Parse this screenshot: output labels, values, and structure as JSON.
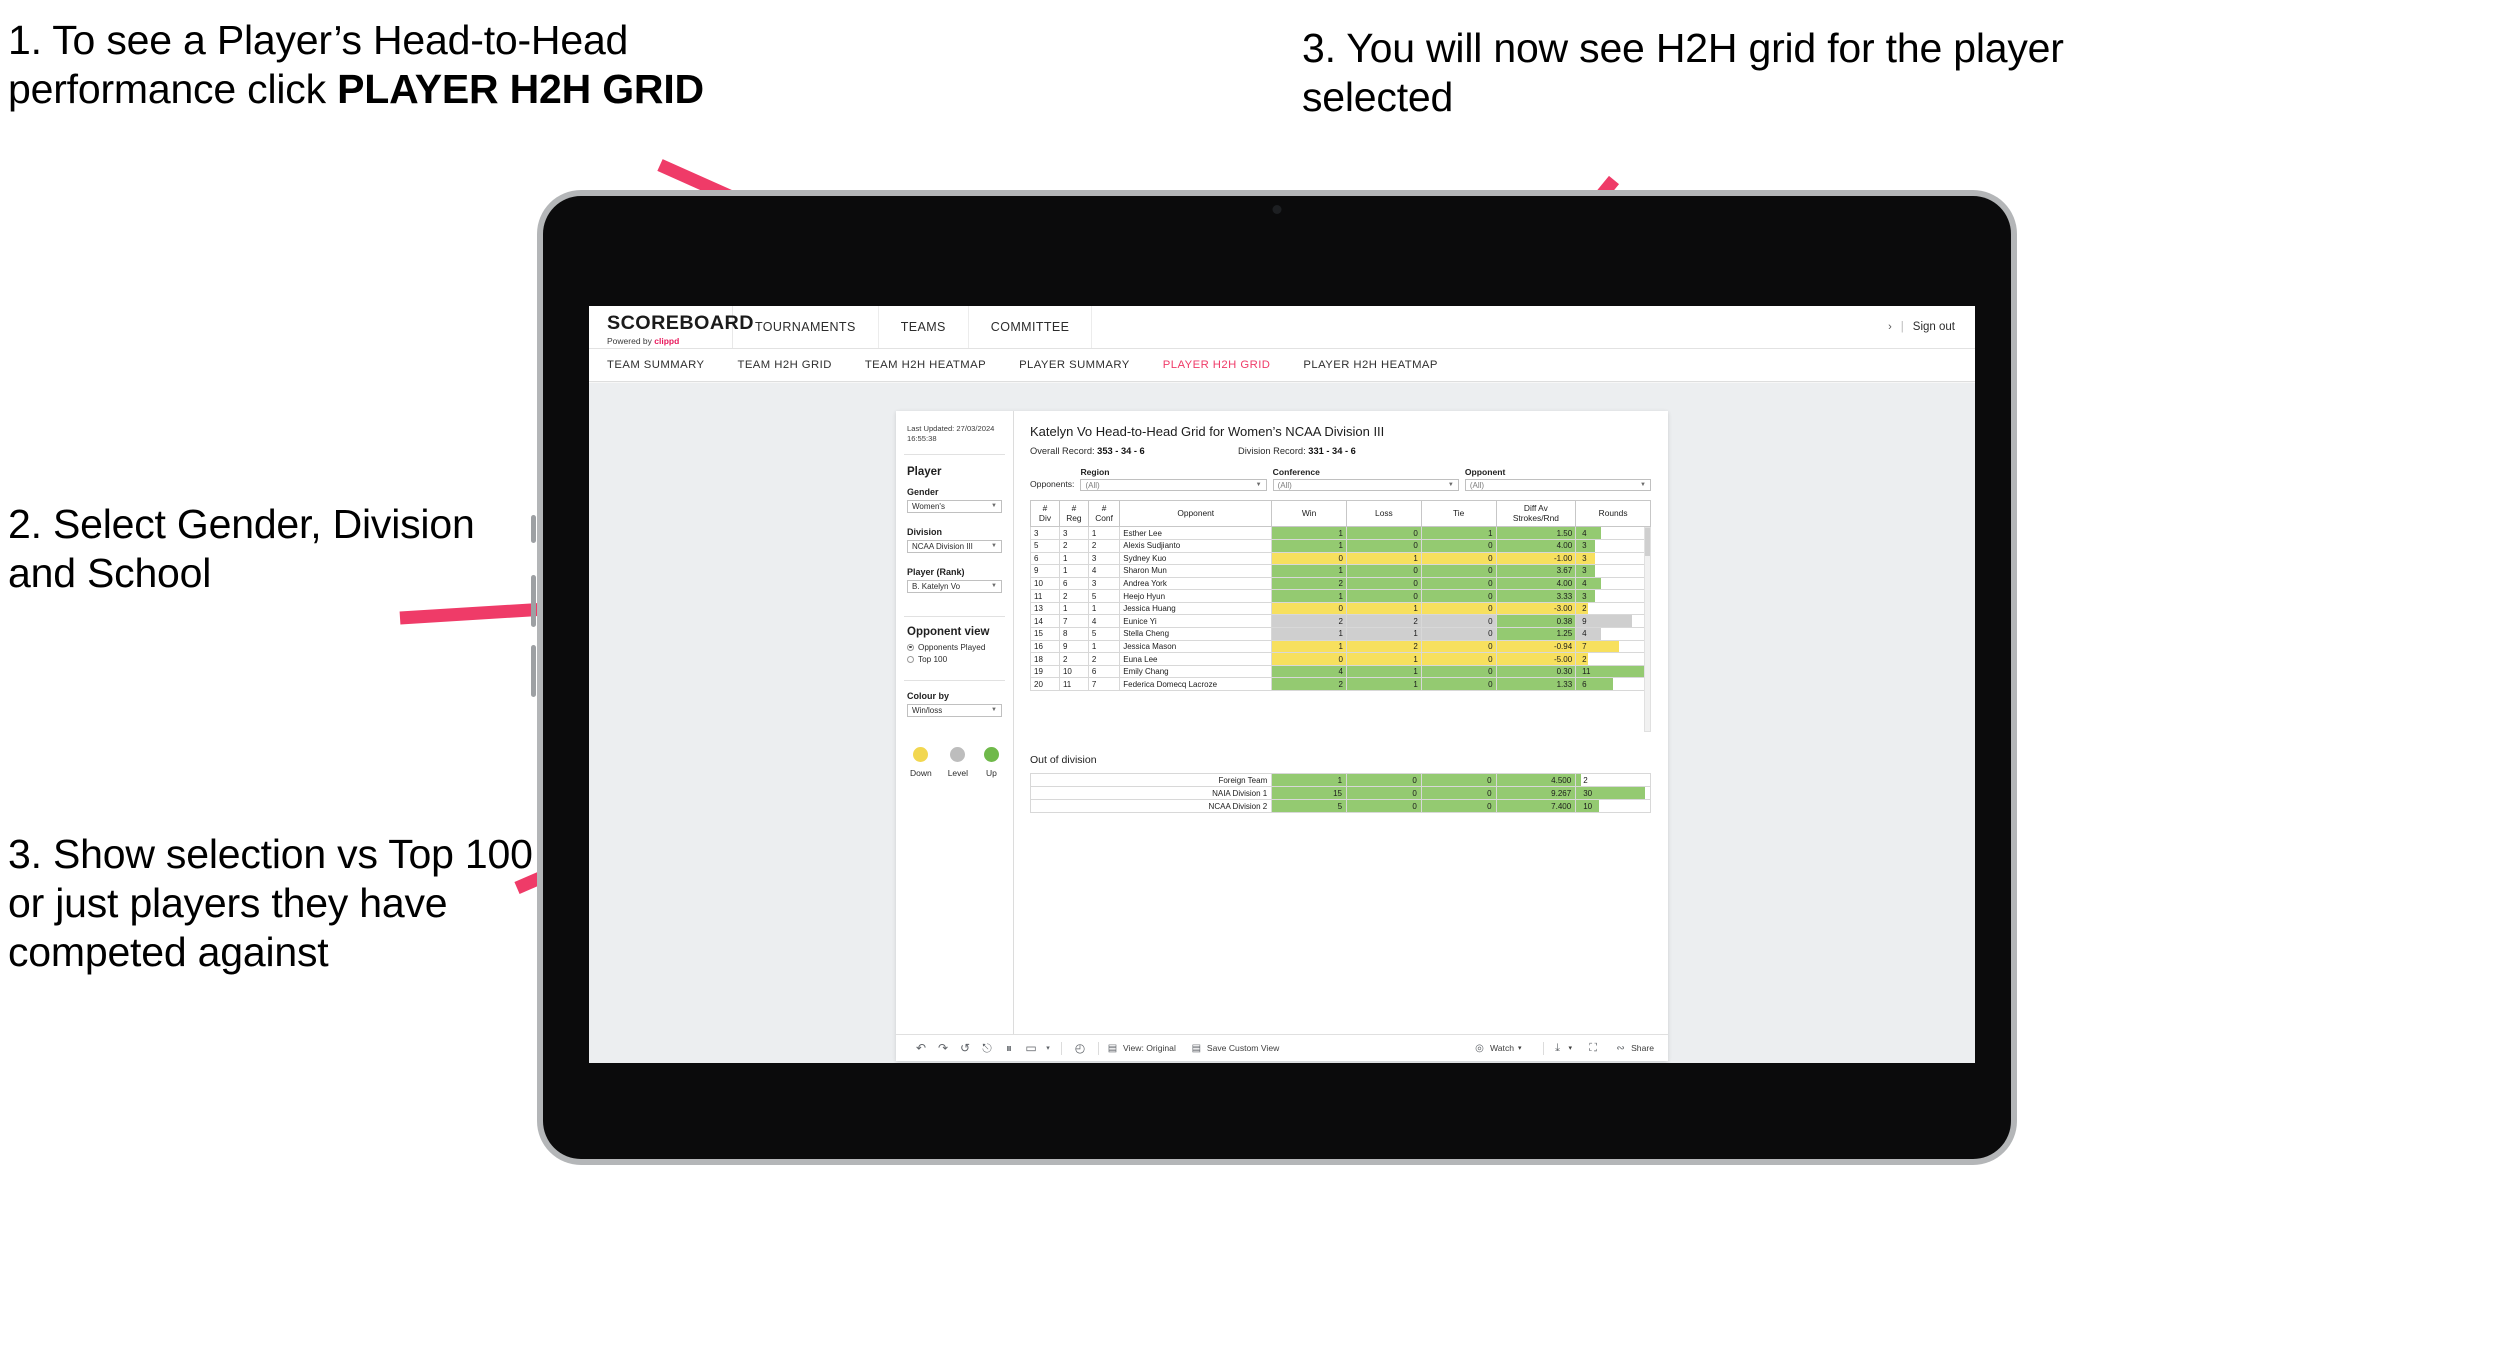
{
  "annotations": [
    {
      "id": "a1",
      "text": "1. To see a Player’s Head-to-Head performance click ",
      "bold": "PLAYER H2H GRID"
    },
    {
      "id": "a2",
      "text": "2. Select Gender, Division and School"
    },
    {
      "id": "a3",
      "text": "3. Show selection vs Top 100 or just players they have competed against"
    },
    {
      "id": "a4",
      "text": "3. You will now see H2H grid for the player selected"
    }
  ],
  "app": {
    "brand": {
      "name": "SCOREBOARD",
      "powered_prefix": "Powered by ",
      "powered_brand": "clippd"
    },
    "topnav": [
      "TOURNAMENTS",
      "TEAMS",
      "COMMITTEE"
    ],
    "account": {
      "chevron": "›",
      "separator": "|",
      "sign_out": "Sign out"
    },
    "subnav": [
      {
        "label": "TEAM SUMMARY",
        "active": false
      },
      {
        "label": "TEAM H2H GRID",
        "active": false
      },
      {
        "label": "TEAM H2H HEATMAP",
        "active": false
      },
      {
        "label": "PLAYER SUMMARY",
        "active": false
      },
      {
        "label": "PLAYER H2H GRID",
        "active": true
      },
      {
        "label": "PLAYER H2H HEATMAP",
        "active": false
      }
    ],
    "accent": "#ef3b68"
  },
  "sidebar": {
    "last_updated": "Last Updated: 27/03/2024 16:55:38",
    "player_section_title": "Player",
    "fields": [
      {
        "label": "Gender",
        "value": "Women's"
      },
      {
        "label": "Division",
        "value": "NCAA Division III"
      },
      {
        "label": "Player (Rank)",
        "value": "B. Katelyn Vo"
      }
    ],
    "opponent_view": {
      "title": "Opponent view",
      "options": [
        {
          "label": "Opponents Played",
          "selected": true
        },
        {
          "label": "Top 100",
          "selected": false
        }
      ]
    },
    "colour_by": {
      "label": "Colour by",
      "value": "Win/loss"
    },
    "legend": [
      {
        "label": "Down",
        "color": "#f2d750"
      },
      {
        "label": "Level",
        "color": "#bdbdbd"
      },
      {
        "label": "Up",
        "color": "#6fb94a"
      }
    ]
  },
  "view": {
    "title": "Katelyn Vo Head-to-Head Grid for Women’s NCAA Division III",
    "overall_record_label": "Overall Record: ",
    "overall_record_value": "353 -  34 - 6",
    "division_record_label": "Division Record: ",
    "division_record_value": "331 -  34 - 6",
    "opponents_label": "Opponents:",
    "filters": [
      {
        "label": "Region",
        "value": "(All)"
      },
      {
        "label": "Conference",
        "value": "(All)"
      },
      {
        "label": "Opponent",
        "value": "(All)"
      }
    ]
  },
  "chart_data": {
    "type": "table",
    "title": "Katelyn Vo Head-to-Head Grid for Women’s NCAA Division III",
    "columns": [
      "# Div",
      "# Reg",
      "# Conf",
      "Opponent",
      "Win",
      "Loss",
      "Tie",
      "Diff Av Strokes/Rnd",
      "Rounds"
    ],
    "column_headers_multiline": [
      [
        "#",
        "Div"
      ],
      [
        "#",
        "Reg"
      ],
      [
        "#",
        "Conf"
      ],
      [
        "Opponent"
      ],
      [
        "Win"
      ],
      [
        "Loss"
      ],
      [
        "Tie"
      ],
      [
        "Diff Av",
        "Strokes/Rnd"
      ],
      [
        "Rounds"
      ]
    ],
    "rounds_max": 12,
    "rows": [
      {
        "div": "3",
        "reg": "3",
        "conf": "1",
        "opponent": "Esther Lee",
        "win": "1",
        "loss": "0",
        "tie": "1",
        "diff": "1.50",
        "rounds": "4",
        "color": "#94ca71"
      },
      {
        "div": "5",
        "reg": "2",
        "conf": "2",
        "opponent": "Alexis Sudjianto",
        "win": "1",
        "loss": "0",
        "tie": "0",
        "diff": "4.00",
        "rounds": "3",
        "color": "#94ca71"
      },
      {
        "div": "6",
        "reg": "1",
        "conf": "3",
        "opponent": "Sydney Kuo",
        "win": "0",
        "loss": "1",
        "tie": "0",
        "diff": "-1.00",
        "rounds": "3",
        "color": "#f7e05e"
      },
      {
        "div": "9",
        "reg": "1",
        "conf": "4",
        "opponent": "Sharon Mun",
        "win": "1",
        "loss": "0",
        "tie": "0",
        "diff": "3.67",
        "rounds": "3",
        "color": "#94ca71"
      },
      {
        "div": "10",
        "reg": "6",
        "conf": "3",
        "opponent": "Andrea York",
        "win": "2",
        "loss": "0",
        "tie": "0",
        "diff": "4.00",
        "rounds": "4",
        "color": "#94ca71"
      },
      {
        "div": "11",
        "reg": "2",
        "conf": "5",
        "opponent": "Heejo Hyun",
        "win": "1",
        "loss": "0",
        "tie": "0",
        "diff": "3.33",
        "rounds": "3",
        "color": "#94ca71"
      },
      {
        "div": "13",
        "reg": "1",
        "conf": "1",
        "opponent": "Jessica Huang",
        "win": "0",
        "loss": "1",
        "tie": "0",
        "diff": "-3.00",
        "rounds": "2",
        "color": "#f7e05e"
      },
      {
        "div": "14",
        "reg": "7",
        "conf": "4",
        "opponent": "Eunice Yi",
        "win": "2",
        "loss": "2",
        "tie": "0",
        "diff": "0.38",
        "rounds": "9",
        "color": "#cfcfcf",
        "diff_color": "#94ca71"
      },
      {
        "div": "15",
        "reg": "8",
        "conf": "5",
        "opponent": "Stella Cheng",
        "win": "1",
        "loss": "1",
        "tie": "0",
        "diff": "1.25",
        "rounds": "4",
        "color": "#cfcfcf",
        "diff_color": "#94ca71"
      },
      {
        "div": "16",
        "reg": "9",
        "conf": "1",
        "opponent": "Jessica Mason",
        "win": "1",
        "loss": "2",
        "tie": "0",
        "diff": "-0.94",
        "rounds": "7",
        "color": "#f7e05e"
      },
      {
        "div": "18",
        "reg": "2",
        "conf": "2",
        "opponent": "Euna Lee",
        "win": "0",
        "loss": "1",
        "tie": "0",
        "diff": "-5.00",
        "rounds": "2",
        "color": "#f7e05e"
      },
      {
        "div": "19",
        "reg": "10",
        "conf": "6",
        "opponent": "Emily Chang",
        "win": "4",
        "loss": "1",
        "tie": "0",
        "diff": "0.30",
        "rounds": "11",
        "color": "#94ca71"
      },
      {
        "div": "20",
        "reg": "11",
        "conf": "7",
        "opponent": "Federica Domecq Lacroze",
        "win": "2",
        "loss": "1",
        "tie": "0",
        "diff": "1.33",
        "rounds": "6",
        "color": "#94ca71"
      }
    ]
  },
  "out_of_division": {
    "title": "Out of division",
    "rounds_max": 32,
    "rows": [
      {
        "name": "Foreign Team",
        "win": "1",
        "loss": "0",
        "tie": "0",
        "diff": "4.500",
        "rounds": "2",
        "color": "#94ca71"
      },
      {
        "name": "NAIA Division 1",
        "win": "15",
        "loss": "0",
        "tie": "0",
        "diff": "9.267",
        "rounds": "30",
        "color": "#94ca71"
      },
      {
        "name": "NCAA Division 2",
        "win": "5",
        "loss": "0",
        "tie": "0",
        "diff": "7.400",
        "rounds": "10",
        "color": "#94ca71"
      }
    ]
  },
  "toolbar": {
    "icons": [
      "undo-icon",
      "redo-icon",
      "revert-icon",
      "refresh-icon",
      "pause-icon",
      "reset-icon"
    ],
    "glyphs": [
      "↶",
      "↷",
      "↺",
      "⎋",
      "⏸",
      "▭"
    ],
    "caret": "▾",
    "clock_glyph": "◴",
    "view_label": "View: Original",
    "save_label": "Save Custom View",
    "watch_label": "Watch",
    "download_glyph": "⤓",
    "fullscreen_glyph": "⛶",
    "share_label": "Share"
  }
}
